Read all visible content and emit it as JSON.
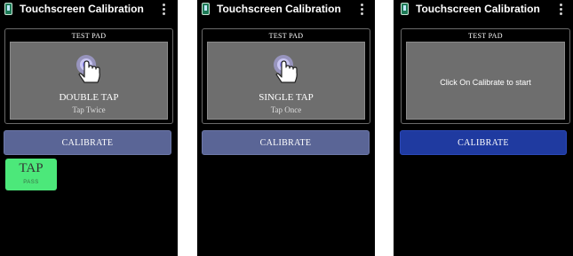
{
  "screens": [
    {
      "title": "Touchscreen Calibration",
      "pad_label": "TEST PAD",
      "tap_title": "DOUBLE TAP",
      "tap_sub": "Tap Twice",
      "hint": "",
      "calibrate": "CALIBRATE",
      "result": "TAP",
      "result_status": "PASS"
    },
    {
      "title": "Touchscreen Calibration",
      "pad_label": "TEST PAD",
      "tap_title": "SINGLE TAP",
      "tap_sub": "Tap Once",
      "hint": "",
      "calibrate": "CALIBRATE"
    },
    {
      "title": "Touchscreen Calibration",
      "pad_label": "TEST PAD",
      "hint": "Click On Calibrate to start",
      "calibrate": "CALIBRATE"
    }
  ],
  "icons": {
    "app": "app-phone-icon",
    "menu": "more-vert-icon",
    "gesture": "touch-hand-icon"
  },
  "colors": {
    "background": "#000000",
    "pad": "#6e6e6e",
    "calibrate_muted": "#5a6596",
    "calibrate_active": "#1f3aa0",
    "pass": "#4ce87a"
  }
}
